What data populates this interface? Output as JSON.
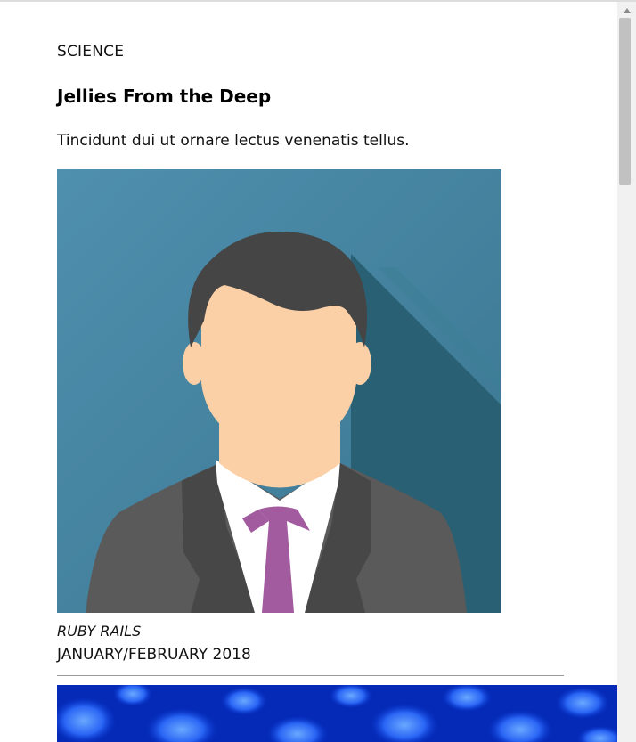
{
  "article": {
    "category": "SCIENCE",
    "title": "Jellies From the Deep",
    "summary": "Tincidunt dui ut ornare lectus venenatis tellus.",
    "author": "RUBY RAILS",
    "issue": "JANUARY/FEBRUARY 2018"
  },
  "icons": {
    "author_photo": "businessman-avatar-illustration",
    "next_image": "blue-jellyfish-photo",
    "scroll_up": "triangle-up-icon"
  },
  "colors": {
    "avatar_background": "#4a8aa8",
    "avatar_shadow": "#2a6074",
    "hair": "#454545",
    "skin": "#fbd0a6",
    "suit": "#5a5a5a",
    "tie": "#a35ba0",
    "jellyfish_blue": "#0a3bd6"
  }
}
